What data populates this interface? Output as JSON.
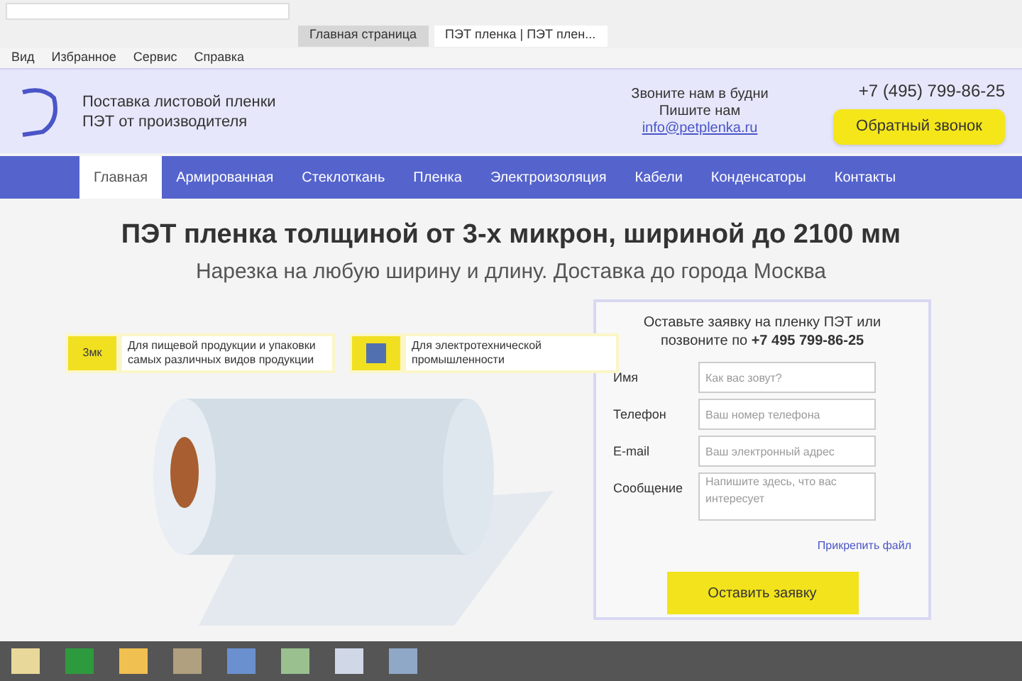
{
  "browser": {
    "tabs": [
      {
        "label": "Главная страница",
        "selected": false
      },
      {
        "label": "ПЭТ пленка | ПЭТ плен...",
        "selected": true
      }
    ],
    "menu": [
      "Вид",
      "Избранное",
      "Сервис",
      "Справка"
    ]
  },
  "header": {
    "tagline": [
      "Поставка листовой пленки",
      "ПЭТ от производителя"
    ],
    "contacts": [
      "Звоните нам в будни",
      "Пишите нам",
      "info@petplenka.ru"
    ],
    "phone": "+7 (495) 799-86-25",
    "callback_button": "Обратный звонок"
  },
  "nav": [
    {
      "label": "Главная",
      "selected": true
    },
    {
      "label": "Армированная",
      "selected": false
    },
    {
      "label": "Стеклоткань",
      "selected": false
    },
    {
      "label": "Пленка",
      "selected": false
    },
    {
      "label": "Электроизоляция",
      "selected": false
    },
    {
      "label": "Кабели",
      "selected": false
    },
    {
      "label": "Конденсаторы",
      "selected": false
    },
    {
      "label": "Контакты",
      "selected": false
    }
  ],
  "hero": {
    "title": "ПЭТ пленка толщиной от 3-х микрон, шириной до 2100 мм",
    "subtitle": "Нарезка на любую ширину и длину. Доставка до города Москва"
  },
  "callouts": [
    {
      "kind": "text",
      "badge": "3мк",
      "text": "Для пищевой продукции и упаковки самых различных видов продукции"
    },
    {
      "kind": "icon",
      "text": "Для электротехнической промышленности"
    }
  ],
  "form": {
    "intro": "Оставьте заявку на пленку ПЭТ или позвоните по **+7 495 799-86-25**",
    "fields": [
      {
        "label": "Имя",
        "placeholder": "Как вас зовут?",
        "kind": "input"
      },
      {
        "label": "Телефон",
        "placeholder": "Ваш номер телефона",
        "kind": "input"
      },
      {
        "label": "E-mail",
        "placeholder": "Ваш электронный адрес",
        "kind": "input"
      },
      {
        "label": "Сообщение",
        "placeholder": "Напишите здесь, что вас интересует",
        "kind": "textarea"
      }
    ],
    "attach_link": "Прикрепить файл",
    "submit_button": "Оставить заявку"
  }
}
